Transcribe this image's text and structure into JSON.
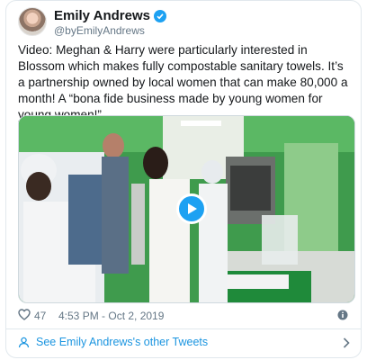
{
  "author": {
    "name": "Emily Andrews",
    "handle": "@byEmilyAndrews",
    "verified": true
  },
  "tweet": {
    "text": "Video: Meghan & Harry were particularly interested in Blossom which makes fully compostable sanitary towels. It’s a partnership owned by local women that can make 80,000 a month! A “bona fide business made by young women for young women!”"
  },
  "media": {
    "type": "video",
    "play_icon": "play-icon"
  },
  "meta": {
    "likes": "47",
    "timestamp": "4:53 PM - Oct 2, 2019"
  },
  "footer": {
    "see_other_label": "See Emily Andrews's other Tweets"
  },
  "colors": {
    "link": "#1b95e0",
    "verified": "#1da1f2",
    "muted": "#657786",
    "border": "#e1e8ed"
  }
}
